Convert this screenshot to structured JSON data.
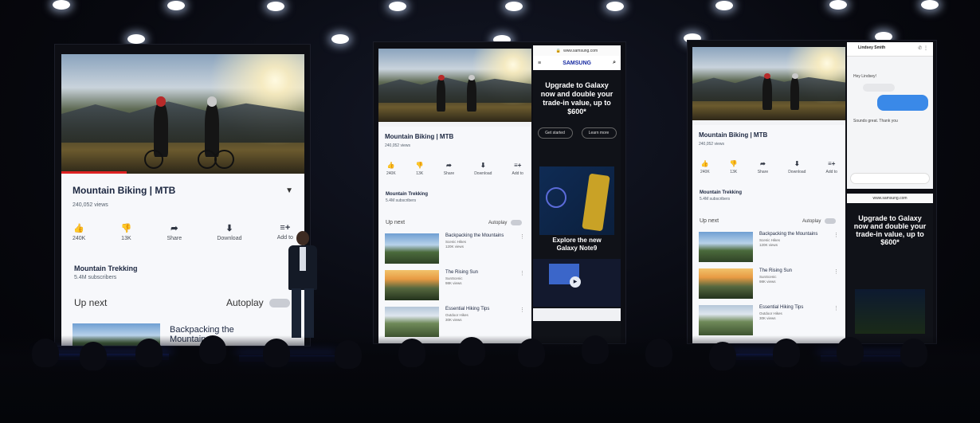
{
  "left_screen": {
    "video_title": "Mountain Biking",
    "video_tag": "MTB",
    "views": "240,052 views",
    "actions": [
      {
        "icon": "like-icon",
        "glyph": "👍",
        "label": "240K"
      },
      {
        "icon": "dislike-icon",
        "glyph": "👎",
        "label": "13K"
      },
      {
        "icon": "share-icon",
        "glyph": "➦",
        "label": "Share"
      },
      {
        "icon": "download-icon",
        "glyph": "⬇",
        "label": "Download"
      },
      {
        "icon": "add-to-icon",
        "glyph": "≡+",
        "label": "Add to"
      }
    ],
    "channel_name": "Mountain Trekking",
    "subscribers": "5.4M subscribers",
    "up_next": "Up next",
    "autoplay": "Autoplay",
    "first_rec_title": "Backpacking the Mountains",
    "progress_fraction": 0.27
  },
  "middle_screen": {
    "video_title": "Mountain Biking",
    "video_tag": "MTB",
    "views": "240,052 views",
    "actions": [
      {
        "icon": "like-icon",
        "glyph": "👍",
        "label": "240K"
      },
      {
        "icon": "dislike-icon",
        "glyph": "👎",
        "label": "13K"
      },
      {
        "icon": "share-icon",
        "glyph": "➦",
        "label": "Share"
      },
      {
        "icon": "download-icon",
        "glyph": "⬇",
        "label": "Download"
      },
      {
        "icon": "add-to-icon",
        "glyph": "≡+",
        "label": "Add to"
      }
    ],
    "channel_name": "Mountain Trekking",
    "subscribers": "5.4M subscribers",
    "up_next": "Up next",
    "autoplay": "Autoplay",
    "recommendations": [
      {
        "title": "Backpacking the Mountains",
        "channel": "Scenic Hikes",
        "views": "120K views",
        "thumb": "mountain"
      },
      {
        "title": "The Rising Sun",
        "channel": "SunScenic",
        "views": "98K views",
        "thumb": "sunset"
      },
      {
        "title": "Essential Hiking Tips",
        "channel": "Outdoor Hikes",
        "views": "30K views",
        "thumb": "green"
      }
    ],
    "browser": {
      "url": "www.samsung.com",
      "brand": "SAMSUNG",
      "headline": "Upgrade to Galaxy now and double your trade-in value, up to $600*",
      "buttons": [
        "Get started",
        "Learn more"
      ],
      "promo": "Explore the new Galaxy Note9"
    }
  },
  "right_screen": {
    "video_title": "Mountain Biking",
    "video_tag": "MTB",
    "views": "240,052 views",
    "actions": [
      {
        "icon": "like-icon",
        "glyph": "👍",
        "label": "240K"
      },
      {
        "icon": "dislike-icon",
        "glyph": "👎",
        "label": "13K"
      },
      {
        "icon": "share-icon",
        "glyph": "➦",
        "label": "Share"
      },
      {
        "icon": "download-icon",
        "glyph": "⬇",
        "label": "Download"
      },
      {
        "icon": "add-to-icon",
        "glyph": "≡+",
        "label": "Add to"
      }
    ],
    "channel_name": "Mountain Trekking",
    "subscribers": "5.4M subscribers",
    "up_next": "Up next",
    "autoplay": "Autoplay",
    "recommendations": [
      {
        "title": "Backpacking the Mountains",
        "channel": "Scenic Hikes",
        "views": "120K views",
        "thumb": "mountain"
      },
      {
        "title": "The Rising Sun",
        "channel": "SunScenic",
        "views": "98K views",
        "thumb": "sunset"
      },
      {
        "title": "Essential Hiking Tips",
        "channel": "Outdoor Hikes",
        "views": "30K views",
        "thumb": "green"
      }
    ],
    "messages": {
      "contact": "Lindsey Smith",
      "lines": [
        "Hey Lindsey!",
        "I can't wait to go!",
        "Sounds great. Thank you"
      ]
    },
    "browser": {
      "url": "www.samsung.com",
      "headline": "Upgrade to Galaxy now and double your trade-in value, up to $600*"
    }
  },
  "colors": {
    "youtube_red": "#dd2222",
    "samsung_blue": "#1428a0",
    "stage_led": "#2a4cff"
  }
}
